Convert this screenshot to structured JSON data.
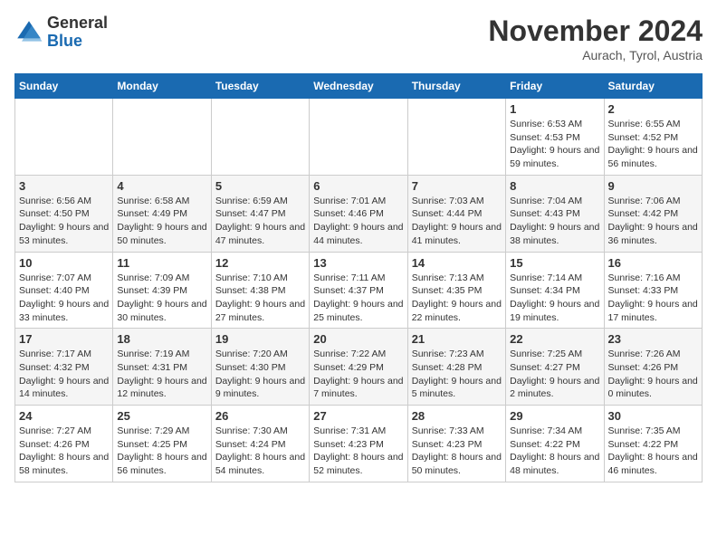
{
  "header": {
    "logo_line1": "General",
    "logo_line2": "Blue",
    "month": "November 2024",
    "location": "Aurach, Tyrol, Austria"
  },
  "weekdays": [
    "Sunday",
    "Monday",
    "Tuesday",
    "Wednesday",
    "Thursday",
    "Friday",
    "Saturday"
  ],
  "weeks": [
    [
      {
        "day": "",
        "info": ""
      },
      {
        "day": "",
        "info": ""
      },
      {
        "day": "",
        "info": ""
      },
      {
        "day": "",
        "info": ""
      },
      {
        "day": "",
        "info": ""
      },
      {
        "day": "1",
        "info": "Sunrise: 6:53 AM\nSunset: 4:53 PM\nDaylight: 9 hours and 59 minutes."
      },
      {
        "day": "2",
        "info": "Sunrise: 6:55 AM\nSunset: 4:52 PM\nDaylight: 9 hours and 56 minutes."
      }
    ],
    [
      {
        "day": "3",
        "info": "Sunrise: 6:56 AM\nSunset: 4:50 PM\nDaylight: 9 hours and 53 minutes."
      },
      {
        "day": "4",
        "info": "Sunrise: 6:58 AM\nSunset: 4:49 PM\nDaylight: 9 hours and 50 minutes."
      },
      {
        "day": "5",
        "info": "Sunrise: 6:59 AM\nSunset: 4:47 PM\nDaylight: 9 hours and 47 minutes."
      },
      {
        "day": "6",
        "info": "Sunrise: 7:01 AM\nSunset: 4:46 PM\nDaylight: 9 hours and 44 minutes."
      },
      {
        "day": "7",
        "info": "Sunrise: 7:03 AM\nSunset: 4:44 PM\nDaylight: 9 hours and 41 minutes."
      },
      {
        "day": "8",
        "info": "Sunrise: 7:04 AM\nSunset: 4:43 PM\nDaylight: 9 hours and 38 minutes."
      },
      {
        "day": "9",
        "info": "Sunrise: 7:06 AM\nSunset: 4:42 PM\nDaylight: 9 hours and 36 minutes."
      }
    ],
    [
      {
        "day": "10",
        "info": "Sunrise: 7:07 AM\nSunset: 4:40 PM\nDaylight: 9 hours and 33 minutes."
      },
      {
        "day": "11",
        "info": "Sunrise: 7:09 AM\nSunset: 4:39 PM\nDaylight: 9 hours and 30 minutes."
      },
      {
        "day": "12",
        "info": "Sunrise: 7:10 AM\nSunset: 4:38 PM\nDaylight: 9 hours and 27 minutes."
      },
      {
        "day": "13",
        "info": "Sunrise: 7:11 AM\nSunset: 4:37 PM\nDaylight: 9 hours and 25 minutes."
      },
      {
        "day": "14",
        "info": "Sunrise: 7:13 AM\nSunset: 4:35 PM\nDaylight: 9 hours and 22 minutes."
      },
      {
        "day": "15",
        "info": "Sunrise: 7:14 AM\nSunset: 4:34 PM\nDaylight: 9 hours and 19 minutes."
      },
      {
        "day": "16",
        "info": "Sunrise: 7:16 AM\nSunset: 4:33 PM\nDaylight: 9 hours and 17 minutes."
      }
    ],
    [
      {
        "day": "17",
        "info": "Sunrise: 7:17 AM\nSunset: 4:32 PM\nDaylight: 9 hours and 14 minutes."
      },
      {
        "day": "18",
        "info": "Sunrise: 7:19 AM\nSunset: 4:31 PM\nDaylight: 9 hours and 12 minutes."
      },
      {
        "day": "19",
        "info": "Sunrise: 7:20 AM\nSunset: 4:30 PM\nDaylight: 9 hours and 9 minutes."
      },
      {
        "day": "20",
        "info": "Sunrise: 7:22 AM\nSunset: 4:29 PM\nDaylight: 9 hours and 7 minutes."
      },
      {
        "day": "21",
        "info": "Sunrise: 7:23 AM\nSunset: 4:28 PM\nDaylight: 9 hours and 5 minutes."
      },
      {
        "day": "22",
        "info": "Sunrise: 7:25 AM\nSunset: 4:27 PM\nDaylight: 9 hours and 2 minutes."
      },
      {
        "day": "23",
        "info": "Sunrise: 7:26 AM\nSunset: 4:26 PM\nDaylight: 9 hours and 0 minutes."
      }
    ],
    [
      {
        "day": "24",
        "info": "Sunrise: 7:27 AM\nSunset: 4:26 PM\nDaylight: 8 hours and 58 minutes."
      },
      {
        "day": "25",
        "info": "Sunrise: 7:29 AM\nSunset: 4:25 PM\nDaylight: 8 hours and 56 minutes."
      },
      {
        "day": "26",
        "info": "Sunrise: 7:30 AM\nSunset: 4:24 PM\nDaylight: 8 hours and 54 minutes."
      },
      {
        "day": "27",
        "info": "Sunrise: 7:31 AM\nSunset: 4:23 PM\nDaylight: 8 hours and 52 minutes."
      },
      {
        "day": "28",
        "info": "Sunrise: 7:33 AM\nSunset: 4:23 PM\nDaylight: 8 hours and 50 minutes."
      },
      {
        "day": "29",
        "info": "Sunrise: 7:34 AM\nSunset: 4:22 PM\nDaylight: 8 hours and 48 minutes."
      },
      {
        "day": "30",
        "info": "Sunrise: 7:35 AM\nSunset: 4:22 PM\nDaylight: 8 hours and 46 minutes."
      }
    ]
  ]
}
